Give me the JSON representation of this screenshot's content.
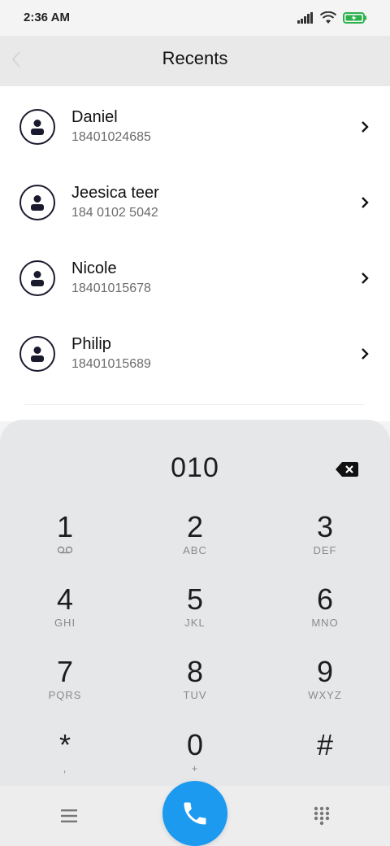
{
  "status_bar": {
    "time": "2:36 AM"
  },
  "header": {
    "title": "Recents"
  },
  "contacts": [
    {
      "name": "Daniel",
      "number": "18401024685"
    },
    {
      "name": "Jeesica teer",
      "number": "184 0102 5042"
    },
    {
      "name": "Nicole",
      "number": "18401015678"
    },
    {
      "name": "Philip",
      "number": "18401015689"
    }
  ],
  "dialpad": {
    "number": "010",
    "keys": [
      {
        "digit": "1",
        "letters": ""
      },
      {
        "digit": "2",
        "letters": "ABC"
      },
      {
        "digit": "3",
        "letters": "DEF"
      },
      {
        "digit": "4",
        "letters": "GHI"
      },
      {
        "digit": "5",
        "letters": "JKL"
      },
      {
        "digit": "6",
        "letters": "MNO"
      },
      {
        "digit": "7",
        "letters": "PQRS"
      },
      {
        "digit": "8",
        "letters": "TUV"
      },
      {
        "digit": "9",
        "letters": "WXYZ"
      },
      {
        "digit": "*",
        "letters": ","
      },
      {
        "digit": "0",
        "letters": "+"
      },
      {
        "digit": "#",
        "letters": ""
      }
    ]
  },
  "icons": {
    "back": "back-arrow-icon",
    "chevron": "chevron-right-icon",
    "delete": "backspace-icon",
    "voicemail": "voicemail-icon",
    "menu": "menu-icon",
    "call": "phone-icon",
    "keypad": "dialpad-icon"
  },
  "colors": {
    "call_button": "#1b9af0",
    "avatar_stroke": "#1a1a2e",
    "battery": "#2bb24c"
  }
}
